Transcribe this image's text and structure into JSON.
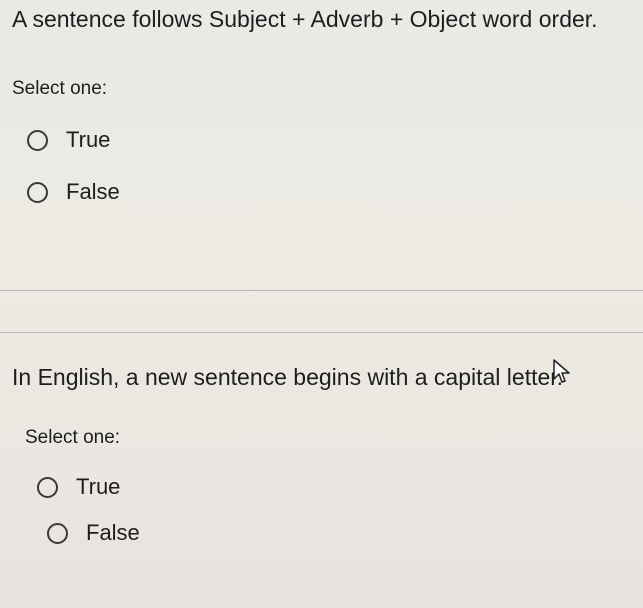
{
  "question1": {
    "text": "A sentence follows Subject + Adverb + Object word order.",
    "prompt": "Select one:",
    "options": [
      "True",
      "False"
    ]
  },
  "question2": {
    "text": "In English, a new sentence begins with a capital letter.",
    "prompt": "Select one:",
    "options": [
      "True",
      "False"
    ]
  }
}
